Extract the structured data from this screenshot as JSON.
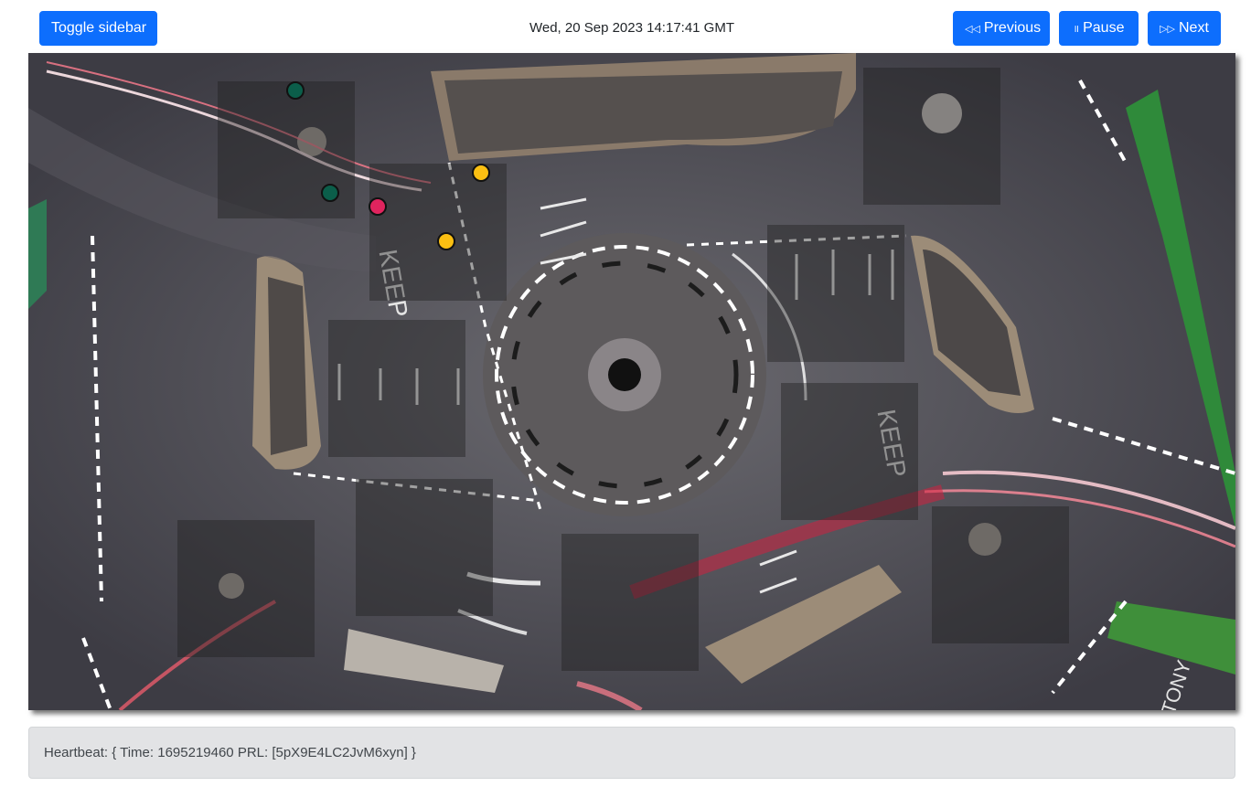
{
  "header": {
    "toggle_label": "Toggle sidebar",
    "datetime": "Wed, 20 Sep 2023 14:17:41 GMT",
    "prev_label": "Previous",
    "pause_label": "Pause",
    "next_label": "Next",
    "prev_icon": "rewind-icon",
    "pause_icon": "pause-icon",
    "next_icon": "fast-forward-icon"
  },
  "scene": {
    "description_icon": "roundabout-aerial-image",
    "markers": [
      {
        "name": "marker-green-1",
        "color": "#0b5e4a"
      },
      {
        "name": "marker-green-2",
        "color": "#0b5e4a"
      },
      {
        "name": "marker-yellow-1",
        "color": "#fbbf12"
      },
      {
        "name": "marker-yellow-2",
        "color": "#fbbf12"
      },
      {
        "name": "marker-red-1",
        "color": "#e0245e"
      }
    ]
  },
  "footer": {
    "heartbeat": "Heartbeat: { Time: 1695219460 PRL: [5pX9E4LC2JvM6xyn] }"
  },
  "colors": {
    "accent": "#0d6efd",
    "footer_bg": "#e2e3e5"
  }
}
